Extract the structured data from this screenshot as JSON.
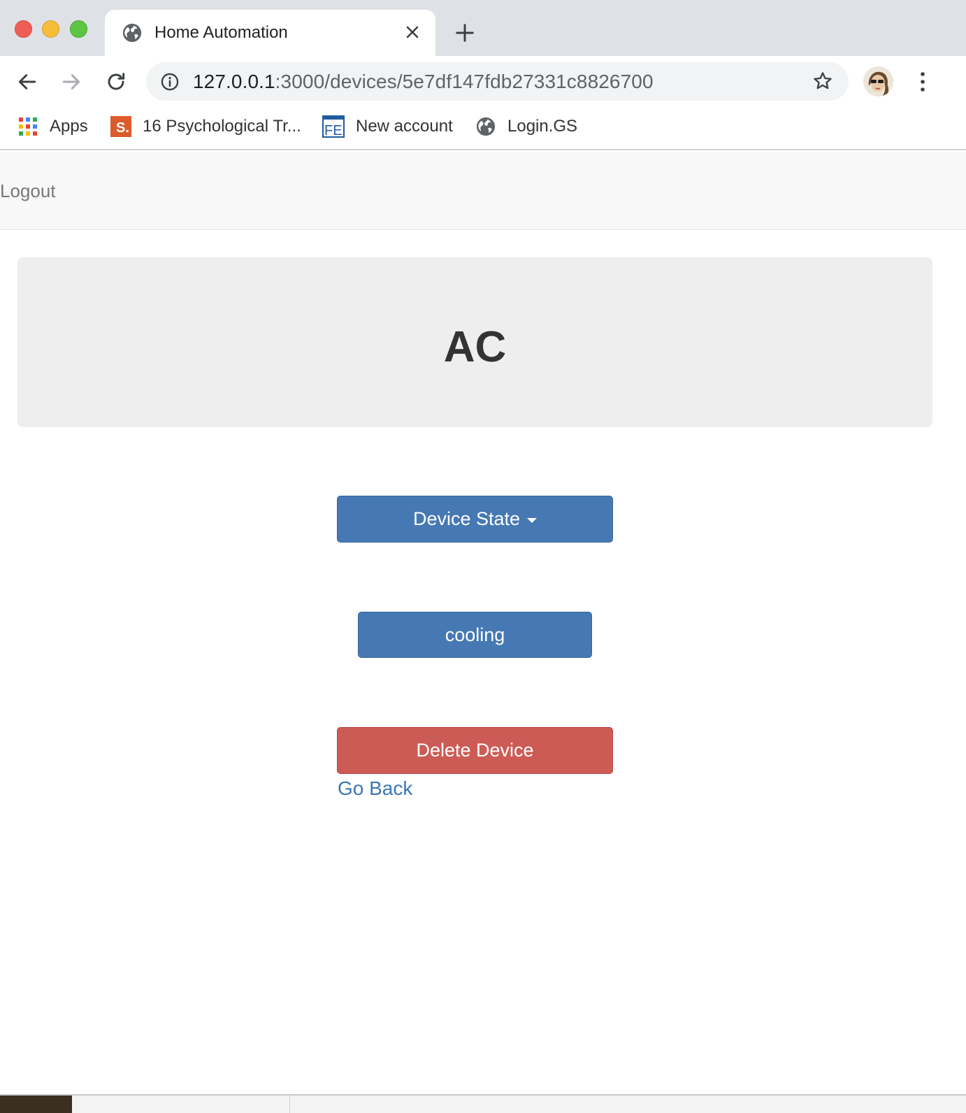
{
  "browser": {
    "tab": {
      "title": "Home Automation"
    },
    "address": {
      "host": "127.0.0.1",
      "path": ":3000/devices/5e7df147fdb27331c8826700"
    },
    "bookmarks": [
      {
        "label": "Apps",
        "icon": "apps-grid-icon"
      },
      {
        "label": "16 Psychological Tr...",
        "icon": "s-favicon-icon"
      },
      {
        "label": "New account",
        "icon": "fe-favicon-icon"
      },
      {
        "label": "Login.GS",
        "icon": "globe-icon"
      }
    ]
  },
  "navbar": {
    "logout_label": "Logout"
  },
  "device": {
    "name": "AC"
  },
  "actions": {
    "state_dropdown_label": "Device State",
    "state_value": "cooling",
    "delete_label": "Delete Device",
    "back_label": "Go Back"
  },
  "colors": {
    "primary": "#4679b3",
    "danger": "#cd5b55",
    "link": "#3a77b7",
    "jumbotron_bg": "#eeeeee"
  }
}
